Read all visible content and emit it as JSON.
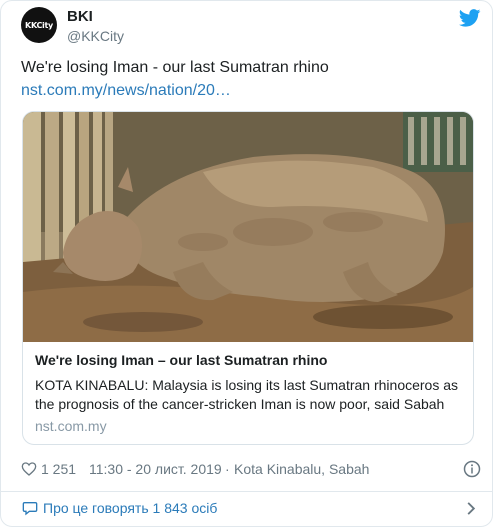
{
  "author": {
    "name": "BKI",
    "handle": "@KKCity",
    "avatar_text": "KKCity"
  },
  "tweet": {
    "text": "We're losing Iman - our last Sumatran rhino",
    "link": "nst.com.my/news/nation/20…"
  },
  "card": {
    "image_icon": "rhino-photo",
    "title": "We're losing Iman – our last Sumatran rhino",
    "description": "KOTA KINABALU: Malaysia is losing its last Sumatran rhinoceros as the prognosis of the cancer-stricken Iman is now poor, said Sabah",
    "domain": "nst.com.my"
  },
  "meta": {
    "like_count": "1 251",
    "timestamp": "11:30 - 20 лист. 2019",
    "separator": "·",
    "location": "Kota Kinabalu, Sabah"
  },
  "conversation": {
    "label": "Про це говорять 1 843 осіб"
  },
  "colors": {
    "link": "#2b7bb9",
    "twitter_blue": "#1da1f2",
    "muted": "#697882"
  }
}
